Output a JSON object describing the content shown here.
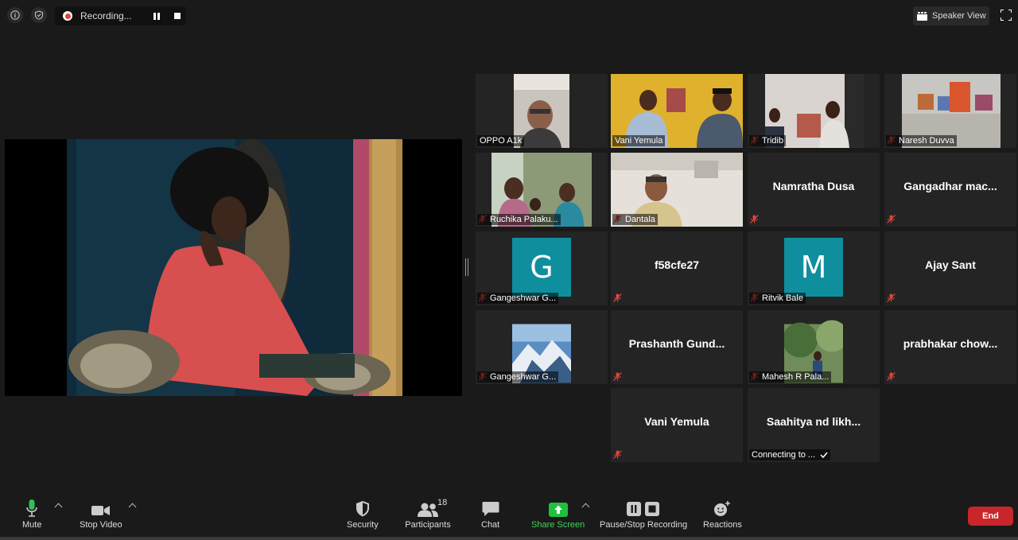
{
  "topbar": {
    "info_icon": "info-icon",
    "shield_icon": "shield-icon",
    "recording_label": "Recording...",
    "speaker_view_label": "Speaker View"
  },
  "participants_grid": [
    {
      "name": "OPPO A1k",
      "muted": false,
      "video": true
    },
    {
      "name": "Vani Yemula",
      "muted": false,
      "video": true,
      "active": true
    },
    {
      "name": "Tridib",
      "muted": true,
      "video": true
    },
    {
      "name": "Naresh Duvva",
      "muted": true,
      "video": true
    },
    {
      "name": "Ruchika Palaku...",
      "muted": true,
      "video": true
    },
    {
      "name": "Dantala",
      "muted": true,
      "video": true
    },
    {
      "name": "Namratha Dusa",
      "muted": true,
      "video": false
    },
    {
      "name": "Gangadhar mac...",
      "muted": true,
      "video": false
    },
    {
      "name": "Gangeshwar G...",
      "muted": true,
      "avatar_letter": "G"
    },
    {
      "name": "f58cfe27",
      "muted": true,
      "video": false
    },
    {
      "name": "Ritvik Bale",
      "muted": true,
      "avatar_letter": "M"
    },
    {
      "name": "Ajay Sant",
      "muted": true,
      "video": false
    },
    {
      "name": "Gangeshwar G...",
      "muted": true,
      "video": true
    },
    {
      "name": "Prashanth Gund...",
      "muted": true,
      "video": false
    },
    {
      "name": "Mahesh R Pala...",
      "muted": true,
      "video": true
    },
    {
      "name": "prabhakar chow...",
      "muted": true,
      "video": false
    },
    {
      "name": "Vani Yemula",
      "muted": true,
      "video": false
    },
    {
      "name": "Saahitya nd likh...",
      "muted": false,
      "video": false,
      "status": "Connecting to ..."
    }
  ],
  "toolbar": {
    "mute_label": "Mute",
    "stop_video_label": "Stop Video",
    "security_label": "Security",
    "participants_label": "Participants",
    "participants_count": "18",
    "chat_label": "Chat",
    "share_screen_label": "Share Screen",
    "pause_stop_recording_label": "Pause/Stop Recording",
    "reactions_label": "Reactions",
    "end_label": "End"
  },
  "colors": {
    "active_speaker": "#c3d82c",
    "share_green": "#1fc13f",
    "end_red": "#c8262a",
    "avatar_teal": "#0f8f9e",
    "muted_red": "#e0453a"
  }
}
